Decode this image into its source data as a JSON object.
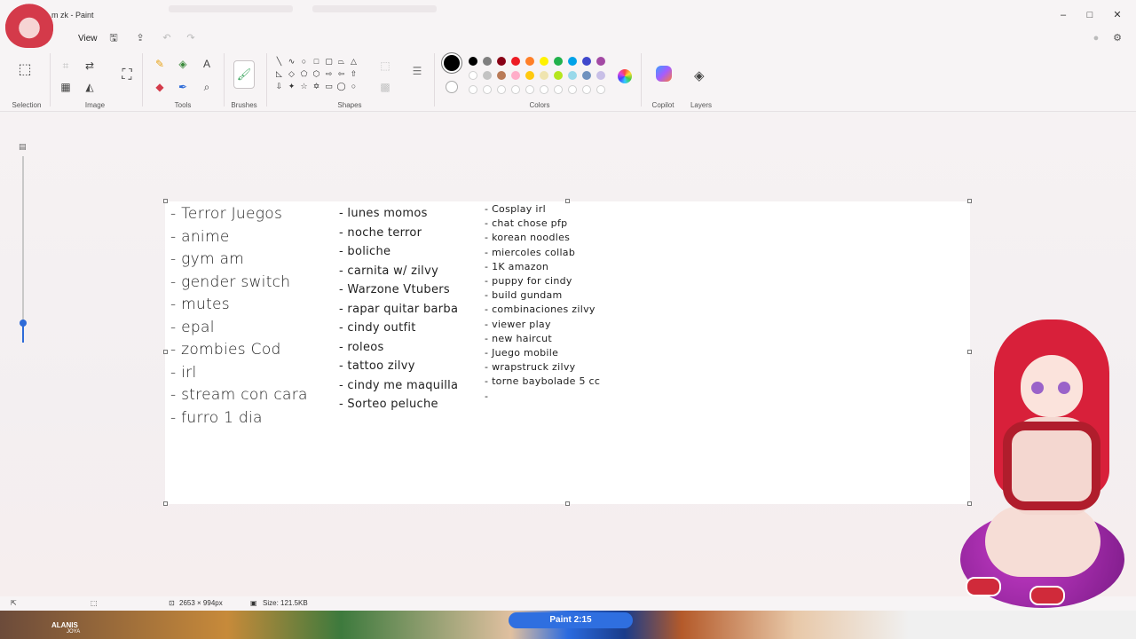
{
  "window": {
    "title": "m zk - Paint",
    "minimize_glyph": "–",
    "maximize_glyph": "□",
    "close_glyph": "✕"
  },
  "menu": {
    "view_label": "View"
  },
  "ribbon": {
    "groups": {
      "selection": "Selection",
      "image": "Image",
      "tools": "Tools",
      "brushes": "Brushes",
      "shapes": "Shapes",
      "colors": "Colors",
      "copilot": "Copilot",
      "layers": "Layers"
    },
    "palette_row1": [
      "#000000",
      "#7f7f7f",
      "#880015",
      "#ed1c24",
      "#ff7f27",
      "#fff200",
      "#22b14c",
      "#00a2e8",
      "#3f48cc",
      "#a349a4"
    ],
    "palette_row2": [
      "#ffffff",
      "#c3c3c3",
      "#b97a57",
      "#ffaec9",
      "#ffc90e",
      "#efe4b0",
      "#b5e61d",
      "#99d9ea",
      "#7092be",
      "#c8bfe7"
    ],
    "palette_row3_empty": 10
  },
  "notes": {
    "col1": [
      "- Terror Juegos",
      "- anime",
      "- gym am",
      "- gender switch",
      "- mutes",
      "- epal",
      "- zombies Cod",
      "- irl",
      "- stream con cara",
      "- furro 1 dia"
    ],
    "col2": [
      "- lunes momos",
      "- noche terror",
      "- boliche",
      "- carnita w/ zilvy",
      "- Warzone Vtubers",
      "- rapar quitar barba",
      "- cindy outfit",
      "- roleos",
      "- tattoo zilvy",
      "- cindy me maquilla",
      "- Sorteo peluche"
    ],
    "col3": [
      "- Cosplay irl",
      "- chat chose pfp",
      "- korean noodles",
      "- miercoles collab",
      "- 1K amazon",
      "- puppy for cindy",
      "- build gundam",
      "- combinaciones zilvy",
      "- viewer play",
      "- new haircut",
      "- Juego mobile",
      "- wrapstruck zilvy",
      "- torne baybolade 5 cc",
      "-"
    ]
  },
  "status": {
    "dimensions": "2653 × 994px",
    "size": "Size: 121.5KB"
  },
  "overlay": {
    "label": "ALANIS",
    "sub": "JOYA",
    "paint_pill": "Paint 2:15"
  }
}
